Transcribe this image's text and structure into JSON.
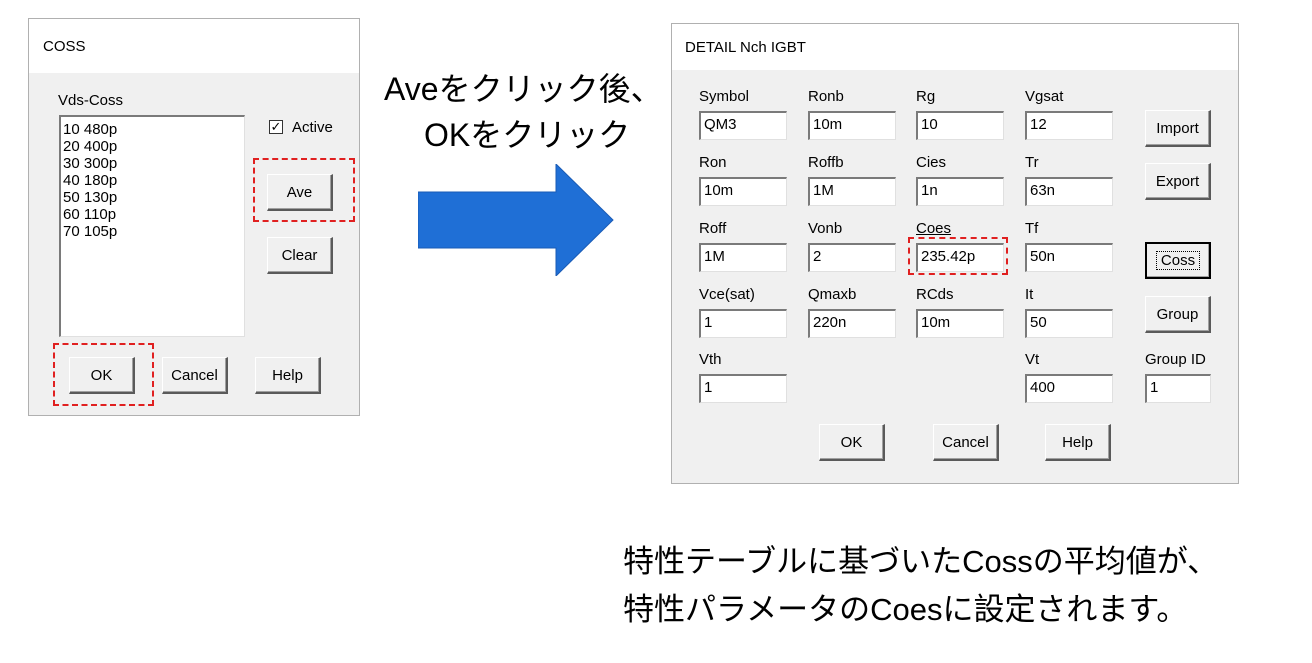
{
  "coss_dialog": {
    "title": "COSS",
    "list_label": "Vds-Coss",
    "items": [
      "10 480p",
      "20 400p",
      "30 300p",
      "40 180p",
      "50 130p",
      "60 110p",
      "70 105p"
    ],
    "active_label": "Active",
    "active_checked": true,
    "active_mark": "✓",
    "ave_label": "Ave",
    "clear_label": "Clear",
    "ok_label": "OK",
    "cancel_label": "Cancel",
    "help_label": "Help"
  },
  "instruction": {
    "line1": "Aveをクリック後、",
    "line2": "OKをクリック"
  },
  "arrow": {
    "color": "#1f6fd6",
    "icon": "right-arrow-icon"
  },
  "detail_dialog": {
    "title": "DETAIL Nch IGBT",
    "fields": [
      {
        "label": "Symbol",
        "value": "QM3"
      },
      {
        "label": "Ronb",
        "value": "10m"
      },
      {
        "label": "Rg",
        "value": "10"
      },
      {
        "label": "Vgsat",
        "value": "12"
      },
      {
        "label": "Ron",
        "value": "10m"
      },
      {
        "label": "Roffb",
        "value": "1M"
      },
      {
        "label": "Cies",
        "value": "1n"
      },
      {
        "label": "Tr",
        "value": "63n"
      },
      {
        "label": "Roff",
        "value": "1M"
      },
      {
        "label": "Vonb",
        "value": "2"
      },
      {
        "label": "Coes",
        "value": "235.42p"
      },
      {
        "label": "Tf",
        "value": "50n"
      },
      {
        "label": "Vce(sat)",
        "value": "1"
      },
      {
        "label": "Qmaxb",
        "value": "220n"
      },
      {
        "label": "RCds",
        "value": "10m"
      },
      {
        "label": "It",
        "value": "50"
      },
      {
        "label": "Vth",
        "value": "1"
      },
      {
        "label": "Vt",
        "value": "400"
      }
    ],
    "group_id_label": "Group ID",
    "group_id_value": "1",
    "import_label": "Import",
    "export_label": "Export",
    "coss_label": "Coss",
    "group_label": "Group",
    "ok_label": "OK",
    "cancel_label": "Cancel",
    "help_label": "Help"
  },
  "caption": {
    "line1": "特性テーブルに基づいたCossの平均値が、",
    "line2": "特性パラメータのCoesに設定されます。"
  },
  "highlight_color": "#e02020"
}
